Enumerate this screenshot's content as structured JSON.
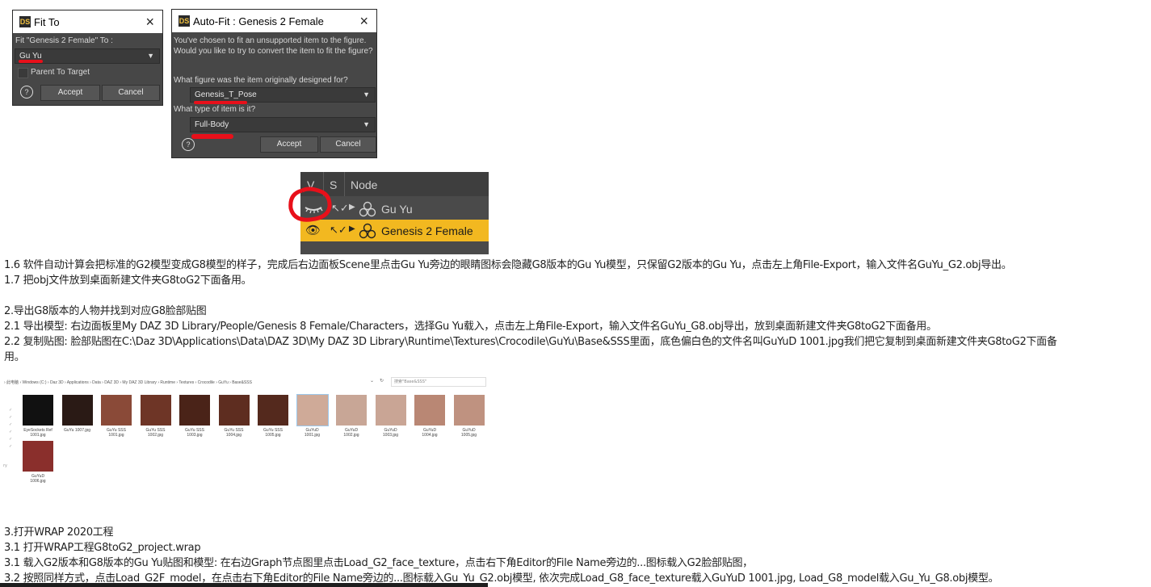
{
  "fit_to_dialog": {
    "title": "Fit To",
    "prompt": "Fit \"Genesis 2 Female\" To :",
    "selected": "Gu Yu",
    "parent_to_target": "Parent To Target",
    "help": "?",
    "accept": "Accept",
    "cancel": "Cancel"
  },
  "autofit_dialog": {
    "title": "Auto-Fit : Genesis 2 Female",
    "message_line1": "You've chosen to fit an unsupported item to the figure.",
    "message_line2": "Would you like to try to convert the item to fit the figure?",
    "question1": "What figure was the item originally designed for?",
    "figure_value": "Genesis_T_Pose",
    "question2": "What type of item is it?",
    "type_value": "Full-Body",
    "help": "?",
    "accept": "Accept",
    "cancel": "Cancel"
  },
  "scene_panel": {
    "col_v": "V",
    "col_s": "S",
    "col_node": "Node",
    "rows": [
      {
        "label": "Gu Yu",
        "highlighted": false
      },
      {
        "label": "Genesis 2 Female",
        "highlighted": true
      }
    ]
  },
  "text": {
    "l1": "1.6 软件自动计算会把标准的G2模型变成G8模型的样子，完成后右边面板Scene里点击Gu Yu旁边的眼睛图标会隐藏G8版本的Gu Yu模型，只保留G2版本的Gu Yu，点击左上角File-Export，输入文件名GuYu_G2.obj导出。",
    "l2": "1.7 把obj文件放到桌面新建文件夹G8toG2下面备用。",
    "l3": "2.导出G8版本的人物并找到对应G8脸部贴图",
    "l4": "2.1 导出模型: 右边面板里My DAZ 3D Library/People/Genesis 8 Female/Characters，选择Gu Yu载入，点击左上角File-Export，输入文件名GuYu_G8.obj导出，放到桌面新建文件夹G8toG2下面备用。",
    "l5": "2.2 复制贴图: 脸部贴图在C:\\Daz 3D\\Applications\\Data\\DAZ 3D\\My DAZ 3D Library\\Runtime\\Textures\\Crocodile\\GuYu\\Base&SSS里面，底色偏白色的文件名叫GuYuD 1001.jpg我们把它复制到桌面新建文件夹G8toG2下面备",
    "l5b": "用。",
    "l6": "3.打开WRAP 2020工程",
    "l7": "3.1 打开WRAP工程G8toG2_project.wrap",
    "l8": "3.1 载入G2版本和G8版本的Gu Yu贴图和模型: 在右边Graph节点图里点击Load_G2_face_texture，点击右下角Editor的File Name旁边的...图标载入G2脸部贴图，",
    "l9": "3.2 按照同样方式，点击Load_G2F_model，在点击右下角Editor的File Name旁边的...图标载入Gu_Yu_G2.obj模型, 依次完成Load_G8_face_texture载入GuYuD 1001.jpg, Load_G8_model载入Gu_Yu_G8.obj模型。"
  },
  "explorer": {
    "breadcrumb": "›  此电脑  ›  Windows (C:)  ›  Daz 3D  ›  Applications  ›  Data  ›  DAZ 3D  ›  My DAZ 3D Library  ›  Runtime  ›  Textures  ›  Crocodile  ›  GuYu  ›  Base&SSS",
    "search": "搜索\"Base&SSS\"",
    "files": [
      {
        "name1": "EyeSockets Ref",
        "name2": "1001.jpg",
        "color": "#111111"
      },
      {
        "name1": "GuYu 1007.jpg",
        "name2": "",
        "color": "#2a1a15"
      },
      {
        "name1": "GuYu SSS",
        "name2": "1001.jpg",
        "color": "#8a4a38"
      },
      {
        "name1": "GuYu SSS",
        "name2": "1002.jpg",
        "color": "#6e3526"
      },
      {
        "name1": "GuYu SSS",
        "name2": "1003.jpg",
        "color": "#4a2318"
      },
      {
        "name1": "GuYu SSS",
        "name2": "1004.jpg",
        "color": "#5e2d20"
      },
      {
        "name1": "GuYu SSS",
        "name2": "1005.jpg",
        "color": "#54291d"
      },
      {
        "name1": "GuYuD",
        "name2": "1001.jpg",
        "color": "#cfaa98"
      },
      {
        "name1": "GuYuD",
        "name2": "1002.jpg",
        "color": "#c8a696"
      },
      {
        "name1": "GuYuD",
        "name2": "1003.jpg",
        "color": "#c9a595"
      },
      {
        "name1": "GuYuD",
        "name2": "1004.jpg",
        "color": "#b98774"
      },
      {
        "name1": "GuYuD",
        "name2": "1005.jpg",
        "color": "#bf9280"
      },
      {
        "name1": "GuYuD",
        "name2": "1006.jpg",
        "color": "#8a2f2c"
      }
    ]
  },
  "colors": {
    "dialog_bg": "#474747",
    "annotation_red": "#e8101a",
    "highlight_row": "#f2b820"
  }
}
